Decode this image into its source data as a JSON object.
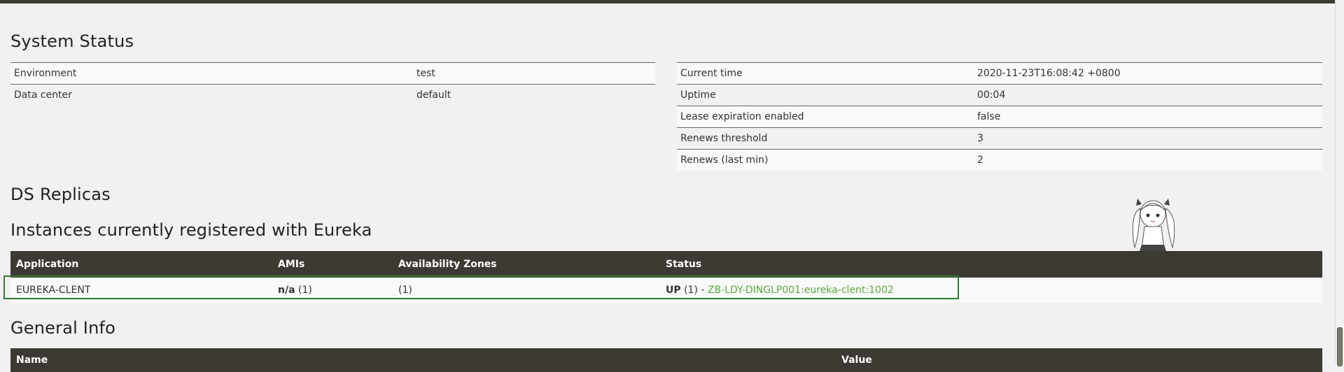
{
  "system_status": {
    "title": "System Status",
    "left_rows": [
      {
        "label": "Environment",
        "value": "test"
      },
      {
        "label": "Data center",
        "value": "default"
      }
    ],
    "right_rows": [
      {
        "label": "Current time",
        "value": "2020-11-23T16:08:42 +0800"
      },
      {
        "label": "Uptime",
        "value": "00:04"
      },
      {
        "label": "Lease expiration enabled",
        "value": "false"
      },
      {
        "label": "Renews threshold",
        "value": "3"
      },
      {
        "label": "Renews (last min)",
        "value": "2"
      }
    ]
  },
  "ds_replicas": {
    "title": "DS Replicas"
  },
  "instances": {
    "title": "Instances currently registered with Eureka",
    "headers": [
      "Application",
      "AMIs",
      "Availability Zones",
      "Status"
    ],
    "rows": [
      {
        "application": "EUREKA-CLENT",
        "amis_bold": "n/a",
        "amis_count": "(1)",
        "zones": "(1)",
        "status_bold": "UP",
        "status_count": "(1) -",
        "status_link": "ZB-LDY-DINGLP001:eureka-clent:1002"
      }
    ]
  },
  "general_info": {
    "title": "General Info",
    "headers": [
      "Name",
      "Value"
    ]
  },
  "colors": {
    "header_bg": "#3d3a34",
    "link": "#5aa93b",
    "highlight_border": "#2e7d32"
  }
}
